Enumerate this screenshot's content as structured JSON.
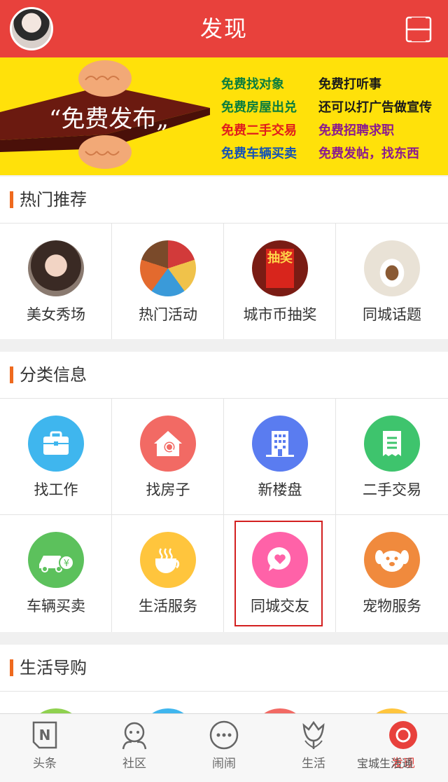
{
  "header": {
    "title": "发现"
  },
  "banner": {
    "slogan": "“免费发布„",
    "left_column": [
      "免费找对象",
      "免费房屋出兑",
      "免费二手交易",
      "免费车辆买卖"
    ],
    "right_column": [
      "免费打听事",
      "还可以打广告做宣传",
      "免费招聘求职",
      "免费发帖，找东西"
    ]
  },
  "sections": {
    "hot": {
      "title": "热门推荐",
      "items": [
        "美女秀场",
        "热门活动",
        "城市币抽奖",
        "同城话题"
      ],
      "lottery_sign": "抽奖"
    },
    "category": {
      "title": "分类信息",
      "row1": [
        "找工作",
        "找房子",
        "新楼盘",
        "二手交易"
      ],
      "row2": [
        "车辆买卖",
        "生活服务",
        "同城交友",
        "宠物服务"
      ]
    },
    "shopping": {
      "title": "生活导购"
    }
  },
  "colors": {
    "header": "#e8413c",
    "banner": "#ffe10a",
    "accent_bar": "#ef6a1e",
    "job": "#3fb6ee",
    "house": "#f26a64",
    "building": "#5a7cf0",
    "trade": "#3ec46d",
    "car": "#5cc15c",
    "life": "#ffc53d",
    "dating": "#ff62a8",
    "pet": "#f08a3d"
  },
  "tabs": [
    {
      "label": "头条",
      "icon": "news-icon"
    },
    {
      "label": "社区",
      "icon": "community-icon"
    },
    {
      "label": "闹闹",
      "icon": "chat-icon"
    },
    {
      "label": "生活",
      "icon": "tulip-icon"
    },
    {
      "label": "发现",
      "icon": "discover-icon",
      "active": true
    }
  ],
  "watermark": "宝城生活通"
}
